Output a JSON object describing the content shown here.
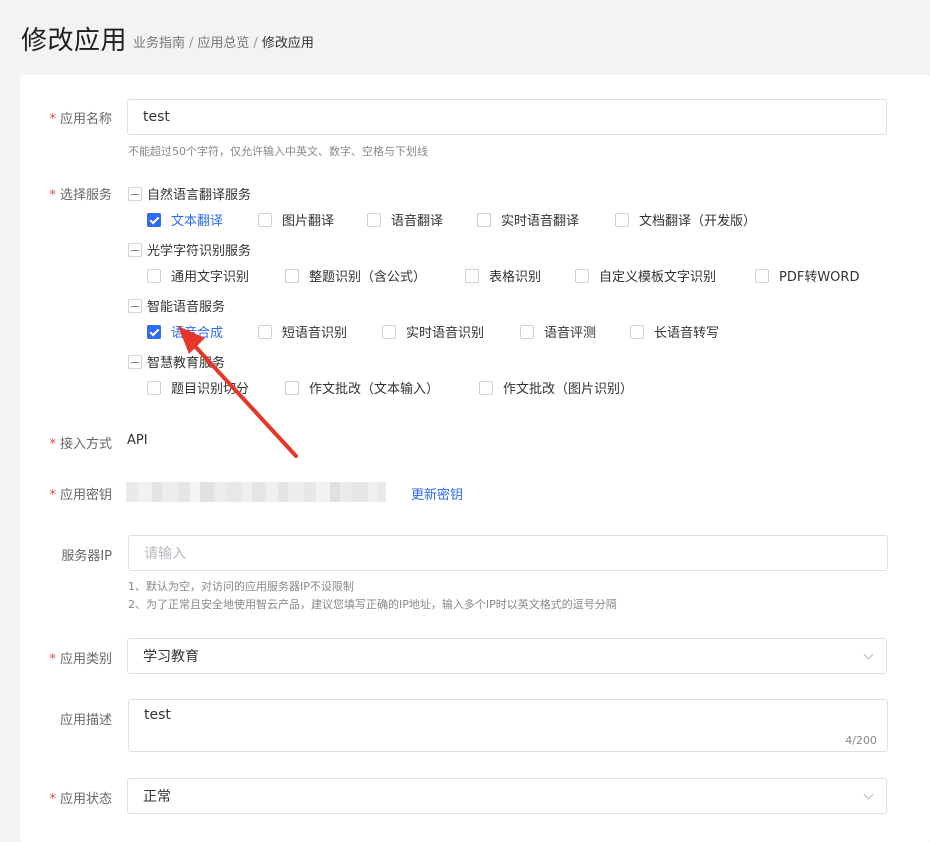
{
  "header": {
    "title": "修改应用",
    "breadcrumb": [
      "业务指南",
      "应用总览",
      "修改应用"
    ]
  },
  "form": {
    "app_name": {
      "label": "应用名称",
      "required": "*",
      "value": "test",
      "hint": "不能超过50个字符，仅允许输入中英文、数字、空格与下划线"
    },
    "services": {
      "label": "选择服务",
      "required": "*",
      "groups": [
        {
          "title": "自然语言翻译服务",
          "options": [
            {
              "label": "文本翻译",
              "checked": true
            },
            {
              "label": "图片翻译",
              "checked": false
            },
            {
              "label": "语音翻译",
              "checked": false
            },
            {
              "label": "实时语音翻译",
              "checked": false
            },
            {
              "label": "文档翻译（开发版）",
              "checked": false
            }
          ]
        },
        {
          "title": "光学字符识别服务",
          "options": [
            {
              "label": "通用文字识别",
              "checked": false
            },
            {
              "label": "整题识别（含公式）",
              "checked": false
            },
            {
              "label": "表格识别",
              "checked": false
            },
            {
              "label": "自定义模板文字识别",
              "checked": false
            },
            {
              "label": "PDF转WORD",
              "checked": false
            }
          ]
        },
        {
          "title": "智能语音服务",
          "options": [
            {
              "label": "语音合成",
              "checked": true
            },
            {
              "label": "短语音识别",
              "checked": false
            },
            {
              "label": "实时语音识别",
              "checked": false
            },
            {
              "label": "语音评测",
              "checked": false
            },
            {
              "label": "长语音转写",
              "checked": false
            }
          ]
        },
        {
          "title": "智慧教育服务",
          "options": [
            {
              "label": "题目识别切分",
              "checked": false
            },
            {
              "label": "作文批改（文本输入）",
              "checked": false
            },
            {
              "label": "作文批改（图片识别）",
              "checked": false
            }
          ]
        }
      ]
    },
    "access_method": {
      "label": "接入方式",
      "required": "*",
      "value": "API"
    },
    "app_secret": {
      "label": "应用密钥",
      "required": "*",
      "update_link": "更新密钥"
    },
    "server_ip": {
      "label": "服务器IP",
      "placeholder": "请输入",
      "hints": [
        "1、默认为空，对访问的应用服务器IP不设限制",
        "2、为了正常且安全地使用智云产品，建议您填写正确的IP地址，输入多个IP时以英文格式的逗号分隔"
      ]
    },
    "app_category": {
      "label": "应用类别",
      "required": "*",
      "value": "学习教育"
    },
    "app_description": {
      "label": "应用描述",
      "value": "test",
      "counter": "4/200"
    },
    "app_status": {
      "label": "应用状态",
      "required": "*",
      "value": "正常"
    }
  },
  "colors": {
    "accent": "#2d6bf0",
    "required": "#e34d4d",
    "annotation_arrow": "#e8352a"
  }
}
